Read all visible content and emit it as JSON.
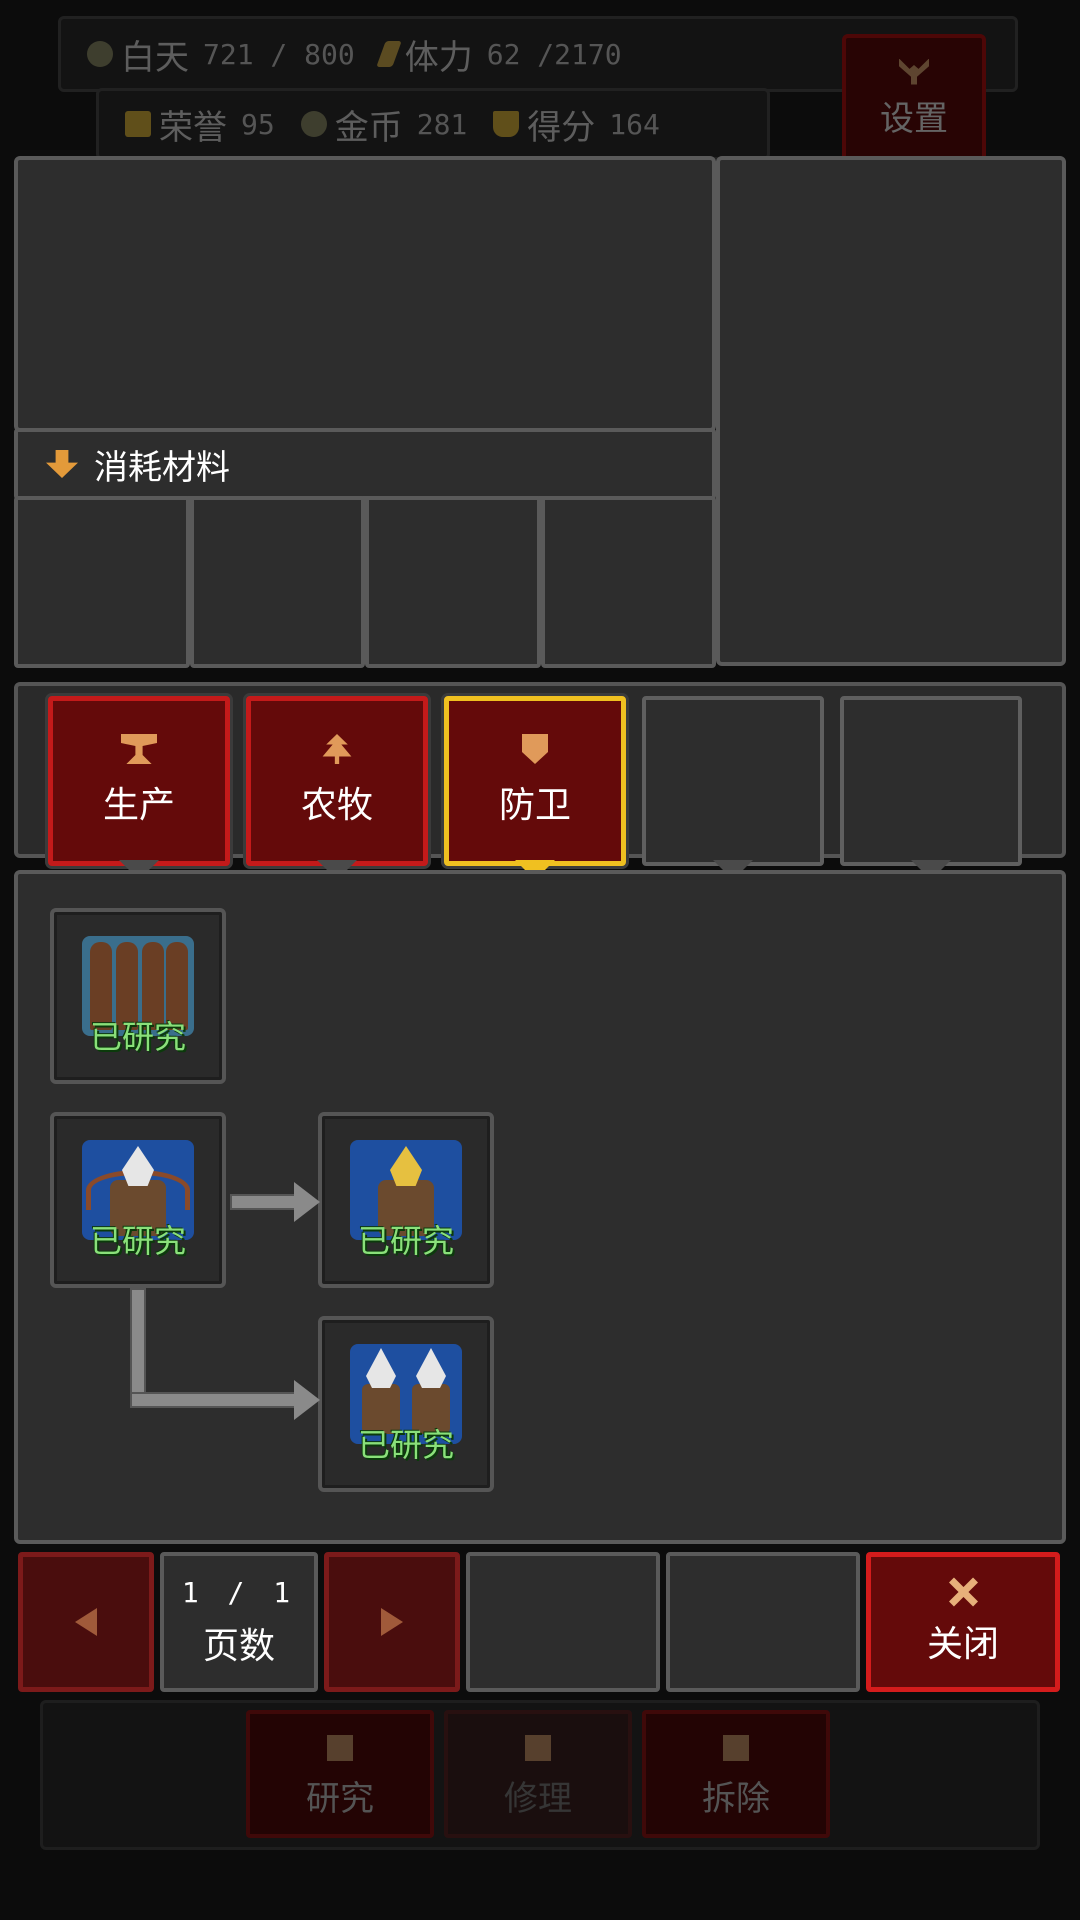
{
  "hud": {
    "daytime_label": "白天",
    "daytime_value": "721 / 800",
    "stamina_label": "体力",
    "stamina_value": "62 /2170",
    "honor_label": "荣誉",
    "honor_value": "95",
    "gold_label": "金币",
    "gold_value": "281",
    "score_label": "得分",
    "score_value": "164",
    "settings_label": "设置"
  },
  "materials": {
    "title": "消耗材料",
    "slots": 4
  },
  "tabs": [
    {
      "label": "生产",
      "icon": "anvil-icon",
      "state": "red"
    },
    {
      "label": "农牧",
      "icon": "tree-icon",
      "state": "red"
    },
    {
      "label": "防卫",
      "icon": "shield-icon",
      "state": "selected"
    },
    {
      "label": "",
      "icon": "",
      "state": "empty"
    },
    {
      "label": "",
      "icon": "",
      "state": "empty"
    }
  ],
  "research_nodes": [
    {
      "name": "spike-trap",
      "status": "已研究"
    },
    {
      "name": "crossbow-turret",
      "status": "已研究"
    },
    {
      "name": "golden-turret",
      "status": "已研究"
    },
    {
      "name": "twin-turret",
      "status": "已研究"
    }
  ],
  "footer": {
    "page_current": "1",
    "page_sep": "/",
    "page_total": "1",
    "page_counter": "1 / 1",
    "page_label": "页数",
    "close_label": "关闭"
  },
  "background_buttons": {
    "research": "研究",
    "repair": "修理",
    "demolish": "拆除"
  },
  "colors": {
    "accent_red": "#c41a1a",
    "selected_gold": "#f0c020",
    "researched_green": "#8ae07a",
    "panel_grey": "#2d2d2d"
  }
}
